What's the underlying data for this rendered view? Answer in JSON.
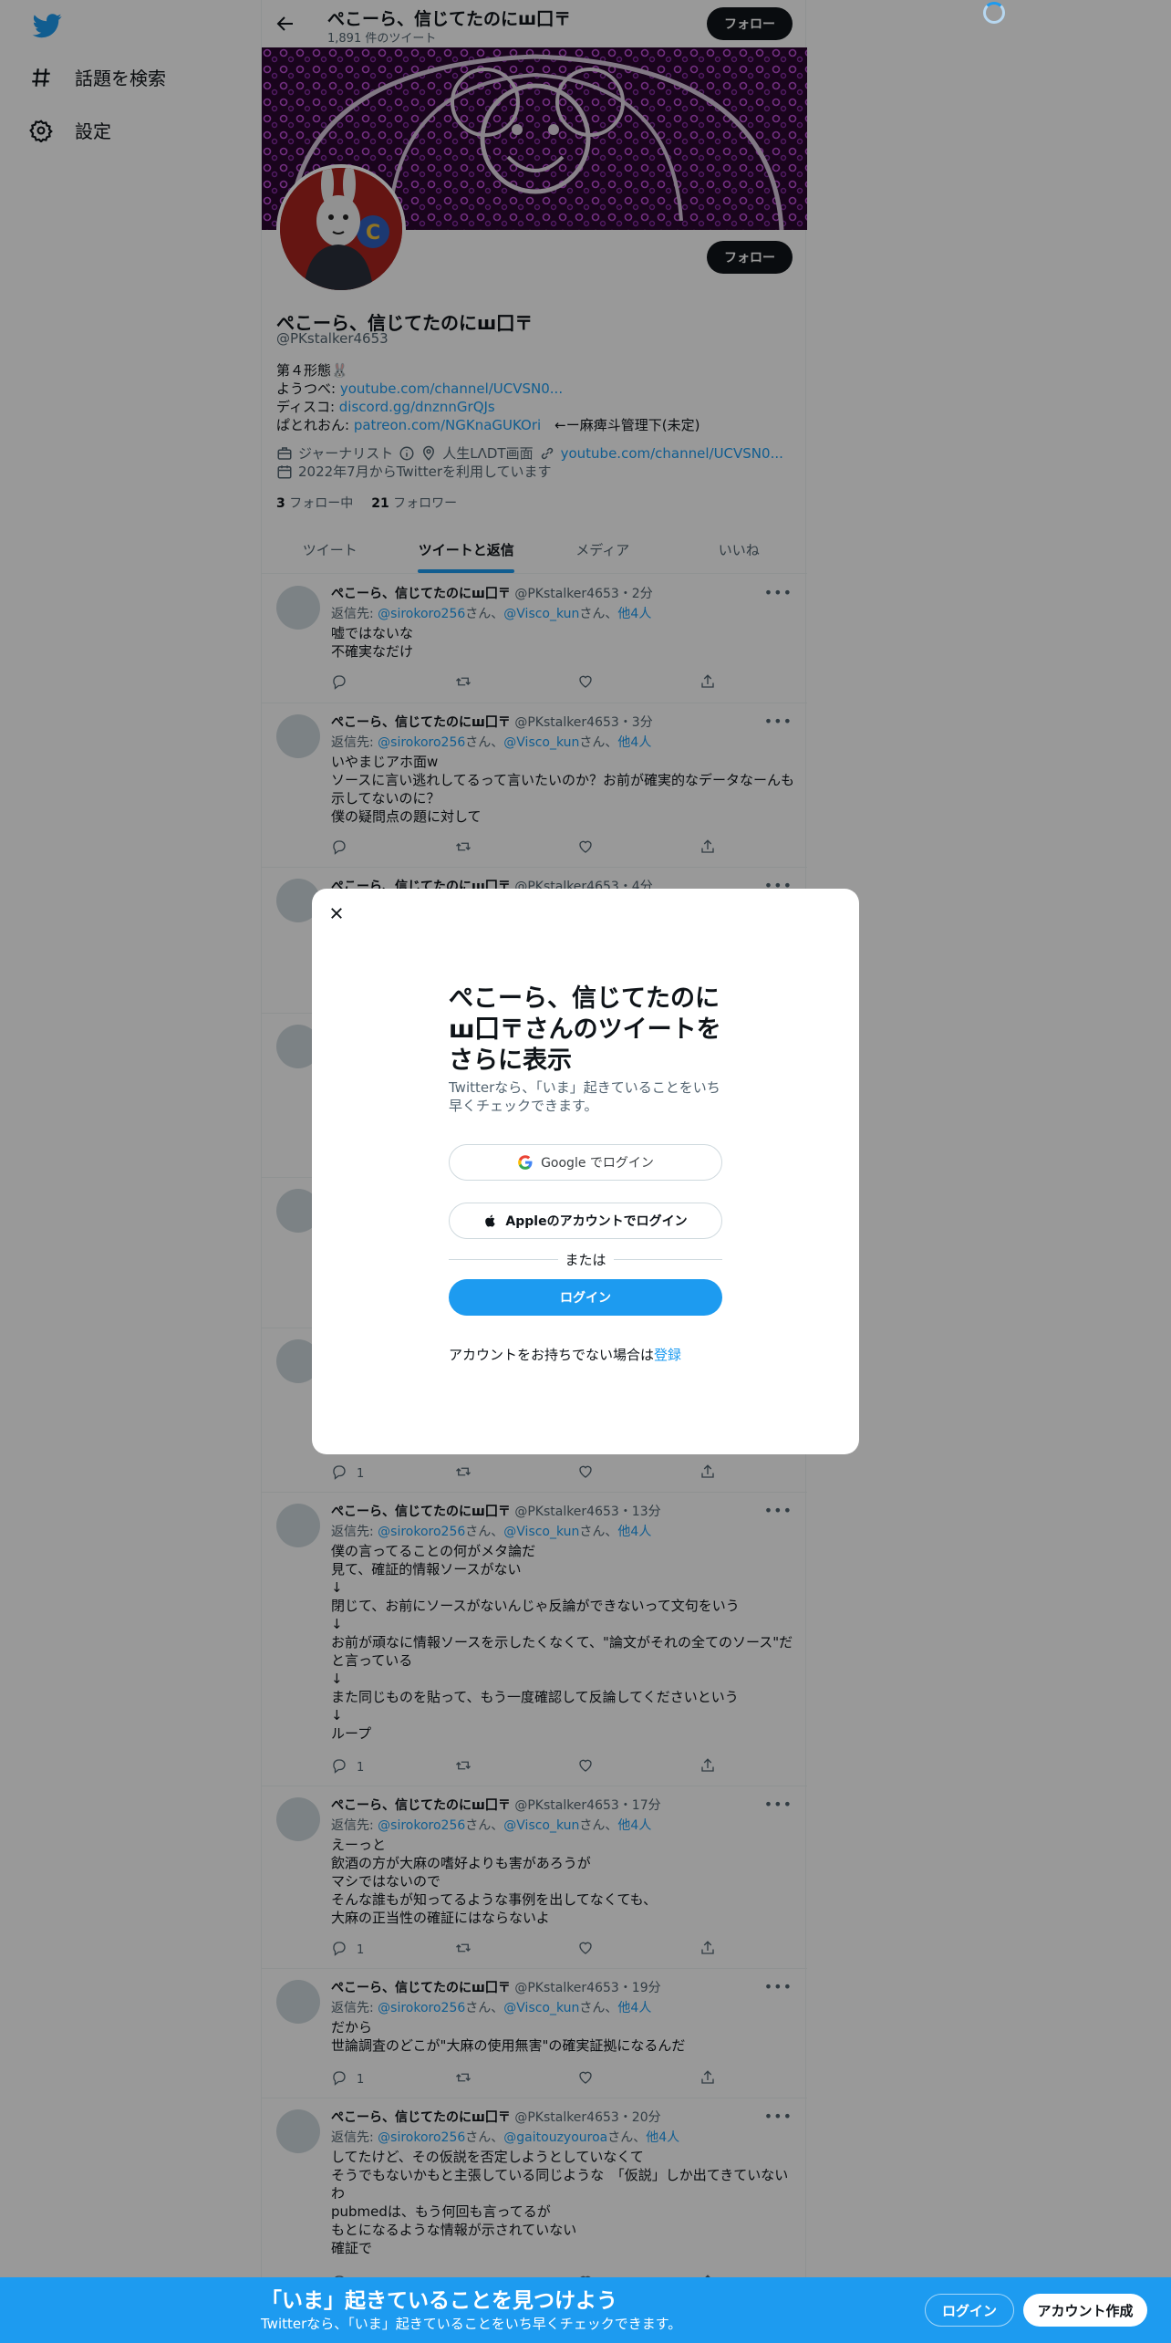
{
  "nav": {
    "explore_label": "話題を検索",
    "settings_label": "設定"
  },
  "topbar": {
    "title": "ぺこーら、信じてたのにш囗〒",
    "tweet_count": "1,891 件のツイート",
    "follow_label": "フォロー"
  },
  "profile": {
    "follow_label": "フォロー",
    "name": "ぺこーら、信じてたのにш囗〒",
    "handle": "@PKstalker4653",
    "bio_line1": "第４形態🐰",
    "bio_youtube_label": "ようつべ: ",
    "bio_youtube_link": "youtube.com/channel/UCVSN0...",
    "bio_discord_label": "ディスコ: ",
    "bio_discord_link": "discord.gg/dnznnGrQJs",
    "bio_patreon_label": "ぱとれおん: ",
    "bio_patreon_link": "patreon.com/NGKnaGUKOri",
    "bio_patreon_suffix": "　←ー麻痺斗管理下(未定)",
    "category": "ジャーナリスト",
    "location": "人生LΛDT画面",
    "website": "youtube.com/channel/UCVSN0...",
    "joined": "2022年7月からTwitterを利用しています",
    "following_count": "3",
    "following_label": "フォロー中",
    "followers_count": "21",
    "followers_label": "フォロワー"
  },
  "tabs": [
    "ツイート",
    "ツイートと返信",
    "メディア",
    "いいね"
  ],
  "tweet_common": {
    "name": "ぺこーら、信じてたのにш囗〒",
    "handle": "@PKstalker4653",
    "reply_prefix": "返信先: ",
    "reply_user1": "@sirokoro256",
    "san": "さん、",
    "reply_user2": "@Visco_kun",
    "others": "他4人"
  },
  "tweets": [
    {
      "time": "・2分",
      "text": "嘘ではないな\n不確実なだけ",
      "reply_count": ""
    },
    {
      "time": "・3分",
      "text": "いやまじアホ面w\nソースに言い逃れしてるって言いたいのか？お前が確実的なデータなーんも示してないのに？\n僕の疑問点の題に対して",
      "reply_count": ""
    },
    {
      "time": "・4分",
      "text": "",
      "reply_count": ""
    },
    {
      "time": "",
      "text": "",
      "reply_count": ""
    },
    {
      "time": "",
      "text": "",
      "reply_count": ""
    },
    {
      "time": "",
      "text": "",
      "reply_count": "1"
    },
    {
      "time": "・13分",
      "text": "僕の言ってることの何がメタ論だ\n見て、確証的情報ソースがない\n↓\n閉じて、お前にソースがないんじゃ反論ができないって文句をいう\n↓\nお前が頑なに情報ソースを示したくなくて、\"論文がそれの全てのソース\"だと言っている\n↓\nまた同じものを貼って、もう一度確認して反論してくださいという\n↓\nループ",
      "reply_count": "1"
    },
    {
      "time": "・17分",
      "text": "えーっと\n飲酒の方が大麻の嗜好よりも害があろうが\nマシではないので\nそんな誰もが知ってるような事例を出してなくても、\n大麻の正当性の確証にはならないよ",
      "reply_count": "1"
    },
    {
      "time": "・19分",
      "text": "だから\n世論調査のどこが\"大麻の使用無害\"の確実証拠になるんだ",
      "reply_count": "1"
    },
    {
      "time": "・20分",
      "text": "してたけど、その仮説を否定しようとしていなくて\nそうでもないかもと主張している同じような　「仮説」しか出てきていないわ\npubmedは、もう何回も言ってるが\nもとになるような情報が示されていない\n確証で",
      "reply_count": ""
    }
  ],
  "tweet9_reply_user2": "@gaitouzyouroa",
  "modal": {
    "title": "ぺこーら、信じてたのにш囗〒さんのツイートをさらに表示",
    "subtitle": "Twitterなら、「いま」起きていることをいち早くチェックできます。",
    "google_label": "Google でログイン",
    "apple_label": "Appleのアカウントでログイン",
    "or_label": "または",
    "login_label": "ログイン",
    "signup_prompt": "アカウントをお持ちでない場合は",
    "signup_link": "登録"
  },
  "bottombar": {
    "title": "「いま」起きていることを見つけよう",
    "subtitle": "Twitterなら、「いま」起きていることをいち早くチェックできます。",
    "login_label": "ログイン",
    "signup_label": "アカウント作成"
  },
  "colors": {
    "accent": "#1d9bf0",
    "text": "#0f1419",
    "muted": "#536471",
    "overlay": "rgba(0,0,0,0.4)"
  }
}
